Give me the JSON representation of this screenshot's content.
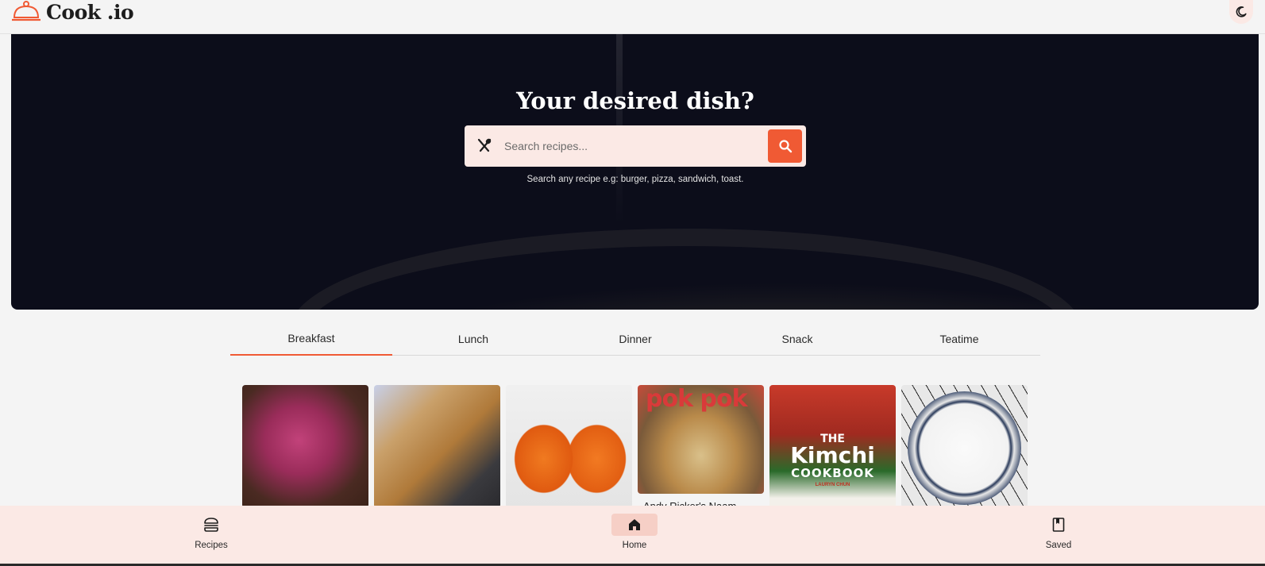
{
  "app": {
    "name": "Cook .io"
  },
  "hero": {
    "title": "Your desired dish?",
    "search_placeholder": "Search recipes...",
    "search_value": "",
    "hint": "Search any recipe e.g: burger, pizza, sandwich, toast."
  },
  "tabs": [
    {
      "label": "Breakfast",
      "active": true
    },
    {
      "label": "Lunch",
      "active": false
    },
    {
      "label": "Dinner",
      "active": false
    },
    {
      "label": "Snack",
      "active": false
    },
    {
      "label": "Teatime",
      "active": false
    }
  ],
  "cards": [
    {
      "image": "berry-smoothie",
      "caption": ""
    },
    {
      "image": "seeded-crackers",
      "caption": ""
    },
    {
      "image": "orange-marmalade-jars",
      "caption": ""
    },
    {
      "image": "pok-pok-cookbook",
      "caption": "Andy Ricker's Naam",
      "cover_text": "pok pok"
    },
    {
      "image": "kimchi-cookbook",
      "caption": "",
      "cover_text": [
        "THE",
        "Kimchi",
        "COOKBOOK",
        "LAURYN CHUN"
      ]
    },
    {
      "image": "bowl-of-rice",
      "caption": ""
    }
  ],
  "bottom_nav": [
    {
      "label": "Recipes",
      "icon": "burger-icon",
      "active": false
    },
    {
      "label": "Home",
      "icon": "home-icon",
      "active": true
    },
    {
      "label": "Saved",
      "icon": "bookmark-icon",
      "active": false
    }
  ],
  "colors": {
    "accent": "#f05a34",
    "surface_tint": "#fbe9e5",
    "background": "#f4f4f4"
  }
}
